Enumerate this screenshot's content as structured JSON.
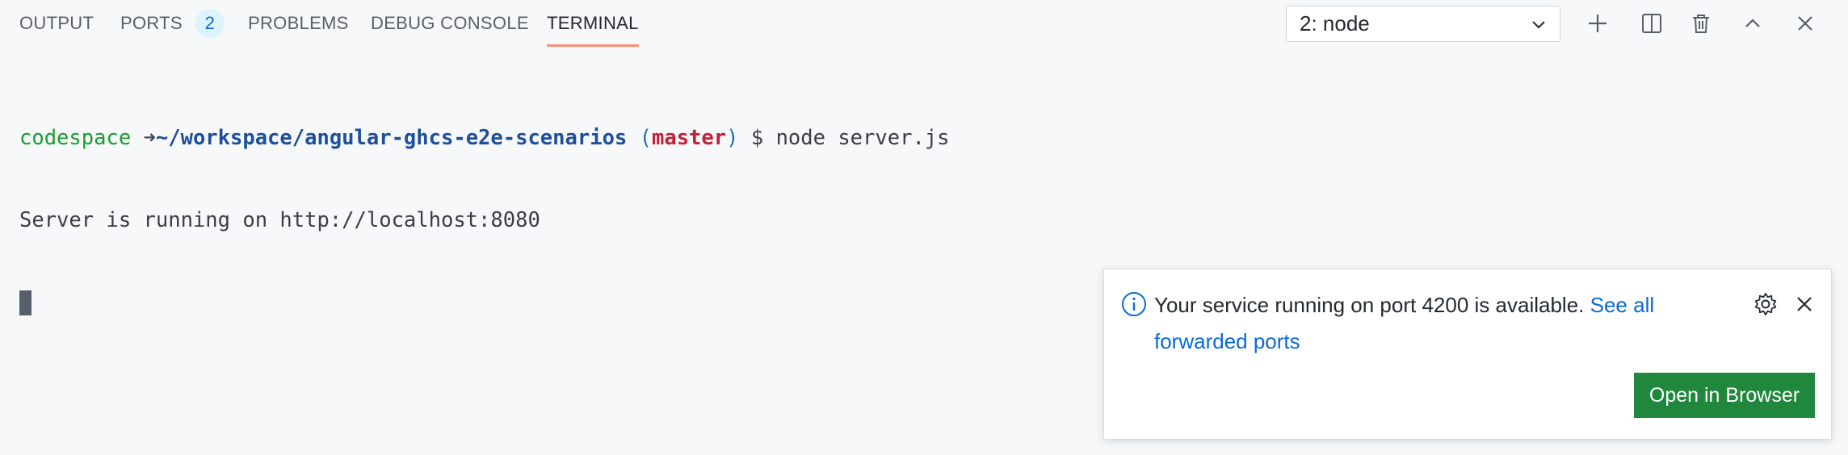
{
  "tabs": [
    {
      "label": "OUTPUT"
    },
    {
      "label": "PORTS",
      "badge": "2"
    },
    {
      "label": "PROBLEMS"
    },
    {
      "label": "DEBUG CONSOLE"
    },
    {
      "label": "TERMINAL",
      "active": true
    }
  ],
  "terminal_select": {
    "value": "2: node"
  },
  "actions": {
    "icons": [
      "plus-icon",
      "split-icon",
      "trash-icon",
      "chevron-up-icon",
      "close-icon"
    ]
  },
  "terminal": {
    "user": "codespace",
    "arrow": "➜",
    "path": "~/workspace/angular-ghcs-e2e-scenarios",
    "paren_open": "(",
    "branch": "master",
    "paren_close": ")",
    "prompt": "$",
    "command": "node server.js",
    "output": "Server is running on http://localhost:8080"
  },
  "toast": {
    "message": "Your service running on port 4200 is available.",
    "link": "See all forwarded ports",
    "button": "Open in Browser"
  },
  "colors": {
    "accent": "#0969da",
    "tab_underline": "#fd8c73",
    "button": "#1f883d",
    "prompt_user": "#1a9f2f",
    "branch": "#c0223a"
  }
}
